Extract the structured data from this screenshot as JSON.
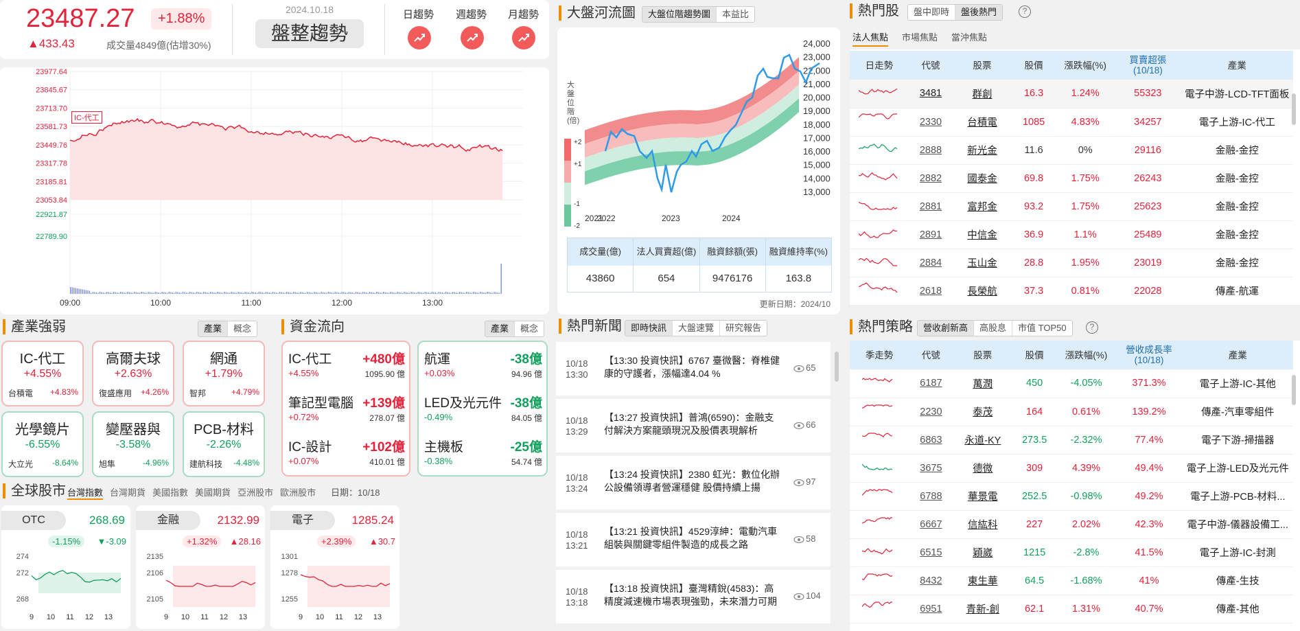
{
  "index": {
    "value": "23487.27",
    "pct": "+1.88%",
    "change": "▲433.43",
    "volume": "成交量4849億(估增30%)",
    "date": "2024.10.18",
    "status": "盤整趨勢",
    "trends": [
      "日趨勢",
      "週趨勢",
      "月趨勢"
    ]
  },
  "intraday": {
    "ylabels": [
      "23977.64",
      "23845.67",
      "23713.70",
      "23581.73",
      "23449.76",
      "23317.78",
      "23185.81",
      "23053.84"
    ],
    "vlabels": [
      "22921.87",
      "22789.90"
    ],
    "xlabels": [
      "09:00",
      "10:00",
      "11:00",
      "12:00",
      "13:00"
    ],
    "tag": "IC-代工"
  },
  "river": {
    "title": "大盤河流圖",
    "tabs": [
      "大盤位階趨勢圖",
      "本益比"
    ],
    "side_label": "大盤位階(倍)",
    "bands": [
      "+2",
      "+1",
      "-1",
      "-2"
    ],
    "ylabels": [
      "24,000",
      "23,000",
      "22,000",
      "21,000",
      "20,000",
      "19,000",
      "18,000",
      "17,000",
      "16,000",
      "15,000",
      "14,000",
      "13,000"
    ],
    "xlabels": [
      "2021",
      "2022",
      "2023",
      "2024"
    ],
    "table_headers": [
      "成交量(億)",
      "法人買賣超(億)",
      "融資餘額(張)",
      "融資維持率(%)"
    ],
    "table_values": [
      "43860",
      "654",
      "9476176",
      "163.8"
    ],
    "updated": "更新日期：2024/10"
  },
  "hot": {
    "title": "熱門股",
    "tabs": [
      "盤中即時",
      "盤後熱門"
    ],
    "help": "?",
    "subtabs": [
      "法人焦點",
      "市場焦點",
      "當沖焦點"
    ],
    "headers": [
      "日走勢",
      "代號",
      "股票",
      "股價",
      "漲跌幅(%)",
      "買賣超張\n(10/18)",
      "產業"
    ],
    "rows": [
      {
        "code": "3481",
        "name": "群創",
        "price": "16.3",
        "chg": "1.24%",
        "vol": "55323",
        "ind": "電子中游-LCD-TFT面板",
        "dir": "up"
      },
      {
        "code": "2330",
        "name": "台積電",
        "price": "1085",
        "chg": "4.83%",
        "vol": "34257",
        "ind": "電子上游-IC-代工",
        "dir": "up"
      },
      {
        "code": "2888",
        "name": "新光金",
        "price": "11.6",
        "chg": "0%",
        "vol": "29116",
        "ind": "金融-金控",
        "dir": "flat"
      },
      {
        "code": "2882",
        "name": "國泰金",
        "price": "69.8",
        "chg": "1.75%",
        "vol": "26243",
        "ind": "金融-金控",
        "dir": "up"
      },
      {
        "code": "2881",
        "name": "富邦金",
        "price": "93.2",
        "chg": "1.75%",
        "vol": "25623",
        "ind": "金融-金控",
        "dir": "up"
      },
      {
        "code": "2891",
        "name": "中信金",
        "price": "36.9",
        "chg": "1.1%",
        "vol": "25489",
        "ind": "金融-金控",
        "dir": "up"
      },
      {
        "code": "2884",
        "name": "玉山金",
        "price": "28.8",
        "chg": "1.95%",
        "vol": "23019",
        "ind": "金融-金控",
        "dir": "up"
      },
      {
        "code": "2618",
        "name": "長榮航",
        "price": "37.3",
        "chg": "0.81%",
        "vol": "22028",
        "ind": "傳產-航運",
        "dir": "up"
      }
    ]
  },
  "industry": {
    "title": "產業強弱",
    "tabs": [
      "產業",
      "概念"
    ],
    "cards": [
      {
        "name": "IC-代工",
        "pct": "+4.55%",
        "stock": "台積電",
        "spct": "+4.83%",
        "dir": "up"
      },
      {
        "name": "高爾夫球",
        "pct": "+2.63%",
        "stock": "復盛應用",
        "spct": "+4.26%",
        "dir": "up"
      },
      {
        "name": "網通",
        "pct": "+1.79%",
        "stock": "智邦",
        "spct": "+4.79%",
        "dir": "up"
      },
      {
        "name": "光學鏡片",
        "pct": "-6.55%",
        "stock": "大立光",
        "spct": "-8.64%",
        "dir": "down"
      },
      {
        "name": "變壓器與",
        "pct": "-3.58%",
        "stock": "旭隼",
        "spct": "-4.96%",
        "dir": "down"
      },
      {
        "name": "PCB-材料",
        "pct": "-2.26%",
        "stock": "建航科技",
        "spct": "-4.48%",
        "dir": "down"
      }
    ]
  },
  "flow": {
    "title": "資金流向",
    "tabs": [
      "產業",
      "概念"
    ],
    "unit": "億",
    "in": [
      {
        "name": "IC-代工",
        "amt": "+480億",
        "pct": "+4.55%",
        "total": "1095.90"
      },
      {
        "name": "筆記型電腦",
        "amt": "+139億",
        "pct": "+0.72%",
        "total": "278.07"
      },
      {
        "name": "IC-設計",
        "amt": "+102億",
        "pct": "+0.07%",
        "total": "410.01"
      }
    ],
    "out": [
      {
        "name": "航運",
        "amt": "-38億",
        "pct": "+0.03%",
        "total": "94.96"
      },
      {
        "name": "LED及光元件",
        "amt": "-38億",
        "pct": "-0.49%",
        "total": "84.05"
      },
      {
        "name": "主機板",
        "amt": "-25億",
        "pct": "-0.38%",
        "total": "54.74"
      }
    ]
  },
  "global": {
    "title": "全球股市",
    "tabs": [
      "台灣指數",
      "台灣期貨",
      "美國指數",
      "美國期貨",
      "亞洲股市",
      "歐洲股市"
    ],
    "date": "日期：10/18",
    "cards": [
      {
        "name": "OTC",
        "value": "268.69",
        "pct": "-1.15%",
        "chg": "▼-3.09",
        "dir": "down",
        "ylabels": [
          "274",
          "272",
          "268"
        ]
      },
      {
        "name": "金融",
        "value": "2132.99",
        "pct": "+1.32%",
        "chg": "▲28.16",
        "dir": "up",
        "ylabels": [
          "2135",
          "2106",
          "2105"
        ]
      },
      {
        "name": "電子",
        "value": "1285.24",
        "pct": "+2.39%",
        "chg": "▲30.7",
        "dir": "up",
        "ylabels": [
          "1301",
          "1278",
          "1255"
        ]
      }
    ],
    "xlabels": [
      "9",
      "10",
      "11",
      "12",
      "13"
    ]
  },
  "news": {
    "title": "熱門新聞",
    "tabs": [
      "即時快訊",
      "大盤速覽",
      "研究報告"
    ],
    "items": [
      {
        "date": "10/18",
        "time": "13:30",
        "text": "【13:30 投資快訊】6767 臺微醫：脊椎健康的守護者，漲幅達4.04 %",
        "views": "65"
      },
      {
        "date": "10/18",
        "time": "13:29",
        "text": "【13:27 投資快訊】普鴻(6590)：金融支付解決方案龍頭現況及股價表現解析",
        "views": "66"
      },
      {
        "date": "10/18",
        "time": "13:24",
        "text": "【13:24 投資快訊】2380 虹光：數位化辦公設備領導者營運穩健 股價持續上揚",
        "views": "97"
      },
      {
        "date": "10/18",
        "time": "13:21",
        "text": "【13:21 投資快訊】4529淳紳：電動汽車組裝與關鍵零組件製造的成長之路",
        "views": "58"
      },
      {
        "date": "10/18",
        "time": "13:18",
        "text": "【13:18 投資快訊】臺灣精銳(4583)：高精度減速機市場表現強勁，未來潛力可期",
        "views": "104"
      }
    ]
  },
  "strategy": {
    "title": "熱門策略",
    "tabs": [
      "營收創新高",
      "高股息",
      "市值 TOP50"
    ],
    "help": "?",
    "headers": [
      "季走勢",
      "代號",
      "股票",
      "股價",
      "漲跌幅(%)",
      "營收成長率\n(10/18)",
      "產業"
    ],
    "rows": [
      {
        "code": "6187",
        "name": "萬潤",
        "price": "450",
        "chg": "-4.05%",
        "growth": "371.3%",
        "ind": "電子上游-IC-其他",
        "dir": "down"
      },
      {
        "code": "2230",
        "name": "泰茂",
        "price": "164",
        "chg": "0.61%",
        "growth": "139.2%",
        "ind": "傳產-汽車零組件",
        "dir": "up"
      },
      {
        "code": "6863",
        "name": "永道-KY",
        "price": "273.5",
        "chg": "-2.32%",
        "growth": "77.4%",
        "ind": "電子下游-掃描器",
        "dir": "down"
      },
      {
        "code": "3675",
        "name": "德微",
        "price": "309",
        "chg": "4.39%",
        "growth": "49.4%",
        "ind": "電子上游-LED及光元件",
        "dir": "up"
      },
      {
        "code": "6788",
        "name": "華景電",
        "price": "252.5",
        "chg": "-0.98%",
        "growth": "49.2%",
        "ind": "電子上游-PCB-材料...",
        "dir": "down"
      },
      {
        "code": "6667",
        "name": "信紘科",
        "price": "227",
        "chg": "2.02%",
        "growth": "42.3%",
        "ind": "電子中游-儀器設備工...",
        "dir": "up"
      },
      {
        "code": "6515",
        "name": "穎崴",
        "price": "1215",
        "chg": "-2.8%",
        "growth": "41.5%",
        "ind": "電子上游-IC-封測",
        "dir": "down"
      },
      {
        "code": "8432",
        "name": "東生華",
        "price": "64.5",
        "chg": "-1.68%",
        "growth": "41%",
        "ind": "傳產-生技",
        "dir": "down"
      },
      {
        "code": "6951",
        "name": "青新-創",
        "price": "62.1",
        "chg": "1.31%",
        "growth": "40.7%",
        "ind": "傳產-其他",
        "dir": "up"
      }
    ]
  },
  "colors": {
    "up": "#e3233a",
    "down": "#11a05c",
    "accent": "#f08c00",
    "header_bg": "#ddeefa"
  }
}
